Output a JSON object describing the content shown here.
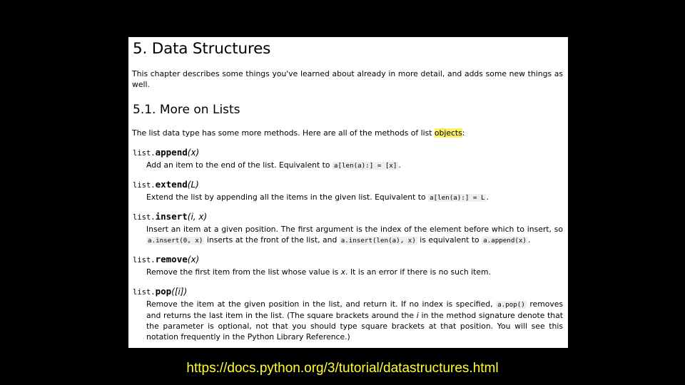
{
  "document": {
    "title": "5. Data Structures",
    "intro": "This chapter describes some things you've learned about already in more detail, and adds some new things as well.",
    "section_title": "5.1. More on Lists",
    "section_intro_before": "The list data type has some more methods. Here are all of the methods of list ",
    "section_intro_highlight": "objects",
    "section_intro_after": ":",
    "methods": [
      {
        "prefix": "list.",
        "name": "append",
        "args": "(x)",
        "desc_1": "Add an item to the end of the list. Equivalent to ",
        "code_1": "a[len(a):] = [x]",
        "desc_2": "."
      },
      {
        "prefix": "list.",
        "name": "extend",
        "args": "(L)",
        "desc_1": "Extend the list by appending all the items in the given list. Equivalent to ",
        "code_1": "a[len(a):] = L",
        "desc_2": "."
      },
      {
        "prefix": "list.",
        "name": "insert",
        "args": "(i, x)",
        "desc_1": "Insert an item at a given position. The first argument is the index of the element before which to insert, so ",
        "code_1": "a.insert(0, x)",
        "desc_2": " inserts at the front of the list, and ",
        "code_2": "a.insert(len(a), x)",
        "desc_3": " is equivalent to ",
        "code_3": "a.append(x)",
        "desc_4": "."
      },
      {
        "prefix": "list.",
        "name": "remove",
        "args": "(x)",
        "desc_1": "Remove the first item from the list whose value is ",
        "em_1": "x",
        "desc_2": ". It is an error if there is no such item."
      },
      {
        "prefix": "list.",
        "name": "pop",
        "args": "([i])",
        "desc_1": "Remove the item at the given position in the list, and return it. If no index is specified, ",
        "code_1": "a.pop()",
        "desc_2": " removes and returns the last item in the list. (The square brackets around the ",
        "em_1": "i",
        "desc_3": " in the method signature denote that the parameter is optional, not that you should type square brackets at that position. You will see this notation frequently in the Python Library Reference.)"
      }
    ]
  },
  "footer": {
    "url": "https://docs.python.org/3/tutorial/datastructures.html"
  },
  "colors": {
    "background": "#000000",
    "page": "#ffffff",
    "url": "#ffff33",
    "highlight": "#fdf067",
    "code_bg": "#eeeeee"
  }
}
